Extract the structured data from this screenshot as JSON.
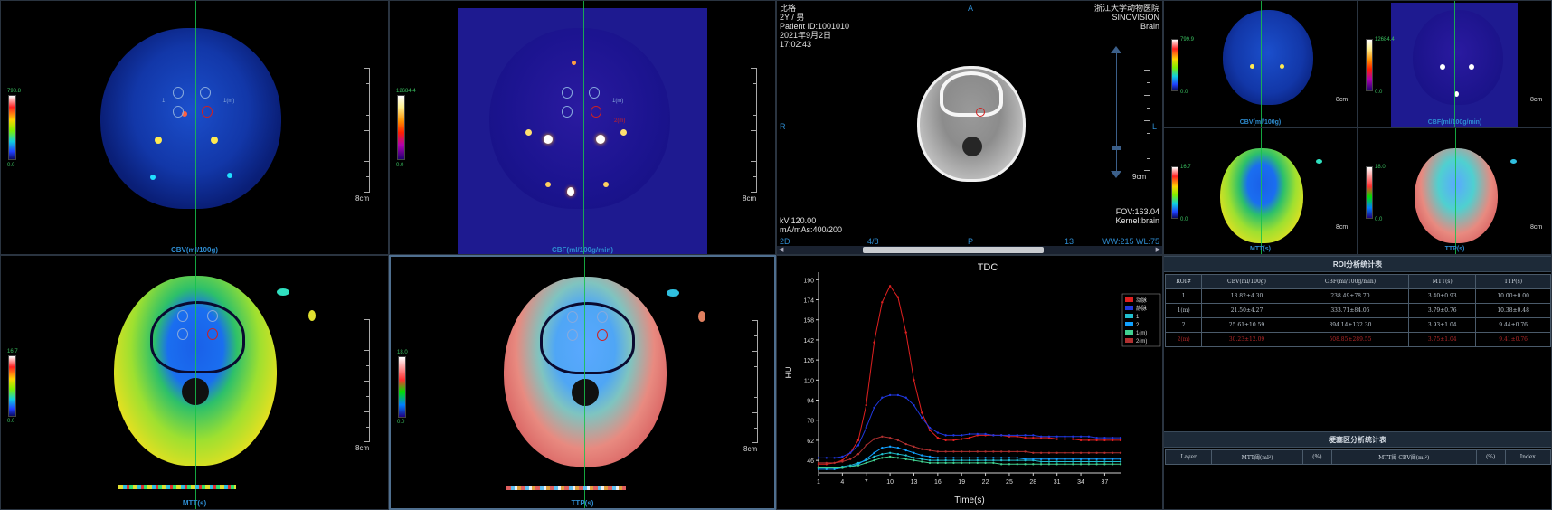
{
  "panels": {
    "cbv": {
      "caption": "CBV(ml/100g)",
      "cbar_max": "798.8",
      "cbar_min": "0.0",
      "ruler_label": "8cm"
    },
    "cbf": {
      "caption": "CBF(ml/100g/min)",
      "cbar_max": "12684.4",
      "cbar_min": "0.0",
      "ruler_label": "8cm"
    },
    "mtt": {
      "caption": "MTT(s)",
      "cbar_max": "16.7",
      "cbar_min": "0.0",
      "ruler_label": "8cm"
    },
    "ttp": {
      "caption": "TTP(s)",
      "cbar_max": "18.0",
      "cbar_min": "0.0",
      "ruler_label": "8cm"
    }
  },
  "roi_labels": [
    "1",
    "1(m)",
    "2",
    "2(m)"
  ],
  "ct": {
    "patient_name": "比格",
    "age_sex": "2Y / 男",
    "patient_id": "Patient ID:1001010",
    "date": "2021年9月2日",
    "time": "17:02:43",
    "hospital": "浙江大学动物医院",
    "vendor": "SINOVISION",
    "body_part": "Brain",
    "orient_top": "A",
    "orient_left": "R",
    "orient_right": "L",
    "orient_bottom": "P",
    "kv": "kV:120.00",
    "mas": "mA/mAs:400/200",
    "fov": "FOV:163.04",
    "kernel": "Kernel:brain",
    "mode": "2D",
    "slice": "4/8",
    "slice_total": "13",
    "window": "WW:215 WL:75",
    "ruler_label": "9cm"
  },
  "mini": {
    "cbv": {
      "caption": "CBV(ml/100g)",
      "cbar_max": "799.9",
      "cbar_min": "0.0",
      "ruler_label": "8cm"
    },
    "cbf": {
      "caption": "CBF(ml/100g/min)",
      "cbar_max": "12684.4",
      "cbar_min": "0.0",
      "ruler_label": "8cm"
    },
    "mtt": {
      "caption": "MTT(s)",
      "cbar_max": "16.7",
      "cbar_min": "0.0",
      "ruler_label": "8cm"
    },
    "ttp": {
      "caption": "TTP(s)",
      "cbar_max": "18.0",
      "cbar_min": "0.0",
      "ruler_label": "8cm"
    }
  },
  "chart_data": {
    "type": "line",
    "title": "TDC",
    "xlabel": "Time(s)",
    "ylabel": "HU",
    "x": [
      1,
      2,
      3,
      4,
      5,
      6,
      7,
      8,
      9,
      10,
      11,
      12,
      13,
      14,
      15,
      16,
      17,
      18,
      19,
      20,
      21,
      22,
      23,
      24,
      25,
      26,
      27,
      28,
      29,
      30,
      31,
      32,
      33,
      34,
      35,
      36,
      37,
      38,
      39
    ],
    "xticks": [
      1,
      4,
      7,
      10,
      13,
      16,
      19,
      22,
      25,
      28,
      31,
      34,
      37
    ],
    "yticks": [
      46,
      62,
      78,
      94,
      110,
      126,
      142,
      158,
      174,
      190
    ],
    "ylim": [
      36,
      196
    ],
    "series": [
      {
        "name": "动脉",
        "color": "#e02020",
        "values": [
          43,
          43,
          44,
          46,
          52,
          62,
          90,
          140,
          172,
          185,
          176,
          148,
          110,
          84,
          70,
          64,
          62,
          62,
          63,
          64,
          66,
          66,
          66,
          66,
          65,
          65,
          64,
          64,
          64,
          64,
          63,
          63,
          63,
          62,
          62,
          62,
          62,
          62,
          62
        ]
      },
      {
        "name": "静脉",
        "color": "#2038e0",
        "values": [
          48,
          48,
          48,
          49,
          52,
          58,
          72,
          88,
          96,
          98,
          98,
          96,
          90,
          80,
          72,
          68,
          66,
          66,
          66,
          67,
          67,
          67,
          66,
          66,
          66,
          66,
          66,
          66,
          65,
          65,
          65,
          65,
          65,
          65,
          65,
          64,
          64,
          64,
          64
        ]
      },
      {
        "name": "1",
        "color": "#20c0d0",
        "values": [
          40,
          40,
          40,
          41,
          42,
          44,
          46,
          49,
          51,
          52,
          51,
          50,
          48,
          47,
          46,
          46,
          46,
          46,
          46,
          46,
          46,
          46,
          46,
          46,
          46,
          46,
          46,
          46,
          45,
          45,
          45,
          45,
          45,
          45,
          45,
          45,
          45,
          45,
          45
        ]
      },
      {
        "name": "2",
        "color": "#10a0ff",
        "values": [
          39,
          39,
          39,
          40,
          41,
          43,
          47,
          52,
          56,
          57,
          56,
          54,
          52,
          50,
          49,
          48,
          48,
          48,
          48,
          48,
          48,
          48,
          48,
          48,
          48,
          48,
          47,
          47,
          47,
          47,
          47,
          47,
          47,
          47,
          47,
          47,
          47,
          47,
          47
        ]
      },
      {
        "name": "1(m)",
        "color": "#40d090",
        "values": [
          40,
          40,
          40,
          40,
          41,
          42,
          44,
          46,
          48,
          49,
          48,
          47,
          46,
          45,
          44,
          44,
          44,
          44,
          44,
          44,
          44,
          44,
          44,
          43,
          43,
          43,
          43,
          43,
          43,
          43,
          43,
          43,
          43,
          43,
          43,
          43,
          43,
          43,
          43
        ]
      },
      {
        "name": "2(m)",
        "color": "#b03030",
        "values": [
          44,
          44,
          44,
          45,
          47,
          51,
          58,
          63,
          65,
          64,
          62,
          59,
          57,
          55,
          54,
          53,
          53,
          53,
          53,
          53,
          53,
          53,
          53,
          53,
          53,
          53,
          53,
          52,
          52,
          52,
          52,
          52,
          52,
          52,
          52,
          52,
          52,
          52,
          52
        ]
      }
    ],
    "legend": "top-right"
  },
  "roi_table": {
    "title": "ROI分析统计表",
    "headers": [
      "ROI#",
      "CBV(ml/100g)",
      "CBF(ml/100g/min)",
      "MTT(s)",
      "TTP(s)"
    ],
    "rows": [
      [
        "1",
        "13.82±4.30",
        "238.49±78.70",
        "3.40±0.93",
        "10.00±0.00"
      ],
      [
        "1(m)",
        "21.50±4.27",
        "333.71±84.05",
        "3.79±0.76",
        "10.38±0.48"
      ],
      [
        "2",
        "25.61±10.59",
        "394.14±132.30",
        "3.93±1.04",
        "9.44±0.76"
      ],
      [
        "2(m)",
        "30.23±12.09",
        "508.85±289.55",
        "3.75±1.04",
        "9.41±0.76"
      ]
    ]
  },
  "infarct_table": {
    "title": "梗塞区分析统计表",
    "headers": [
      "Layer",
      "MTT阈(ml²)",
      "(%)",
      "MTT阈 CBV阈(ml²)",
      "(%)",
      "Index"
    ]
  }
}
